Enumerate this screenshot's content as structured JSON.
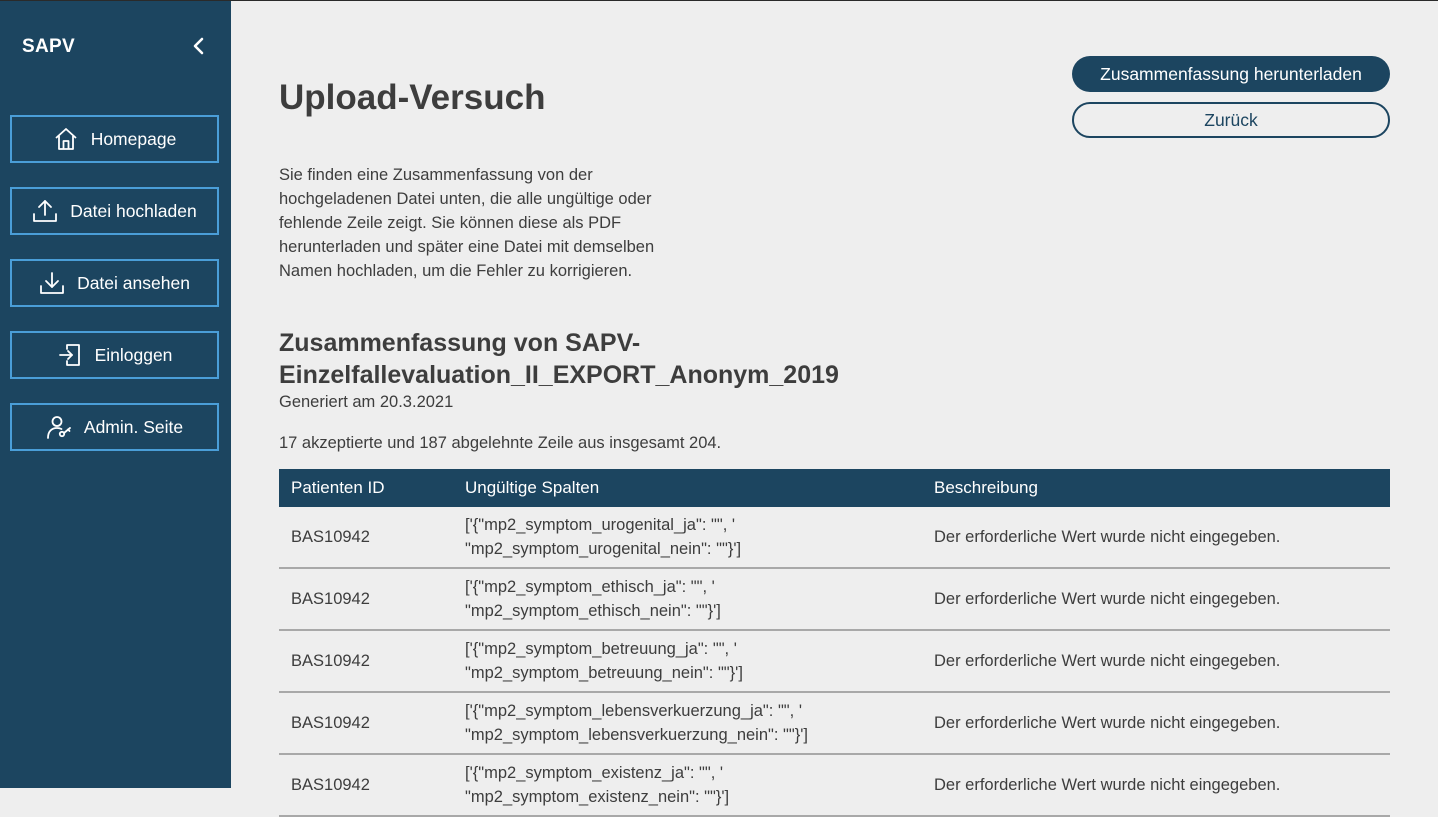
{
  "sidebar": {
    "brand": "SAPV",
    "items": [
      {
        "label": "Homepage",
        "icon": "home-icon"
      },
      {
        "label": "Datei hochladen",
        "icon": "upload-icon"
      },
      {
        "label": "Datei ansehen",
        "icon": "download-icon"
      },
      {
        "label": "Einloggen",
        "icon": "login-icon"
      },
      {
        "label": "Admin. Seite",
        "icon": "admin-user-icon"
      }
    ]
  },
  "header": {
    "title": "Upload-Versuch",
    "download_label": "Zusammenfassung herunterladen",
    "back_label": "Zurück"
  },
  "intro": "Sie finden eine Zusammenfassung von der hochgeladenen Datei unten, die alle ungültige oder fehlende Zeile zeigt. Sie können diese als PDF herunterladen und später eine Datei mit demselben Namen hochladen, um die Fehler zu korrigieren.",
  "summary": {
    "title": "Zusammenfassung von SAPV-Einzelfallevaluation_II_EXPORT_Anonym_2019",
    "generated": "Generiert am 20.3.2021",
    "counts": "17 akzeptierte und 187 abgelehnte Zeile aus insgesamt 204."
  },
  "table": {
    "headers": [
      "Patienten ID",
      "Ungültige Spalten",
      "Beschreibung"
    ],
    "rows": [
      {
        "id": "BAS10942",
        "columns": "['{\"mp2_symptom_urogenital_ja\": \"\", '\n\"mp2_symptom_urogenital_nein\": \"\"}']",
        "description": "Der erforderliche Wert wurde nicht eingegeben."
      },
      {
        "id": "BAS10942",
        "columns": "['{\"mp2_symptom_ethisch_ja\": \"\", '\n\"mp2_symptom_ethisch_nein\": \"\"}']",
        "description": "Der erforderliche Wert wurde nicht eingegeben."
      },
      {
        "id": "BAS10942",
        "columns": "['{\"mp2_symptom_betreuung_ja\": \"\", '\n\"mp2_symptom_betreuung_nein\": \"\"}']",
        "description": "Der erforderliche Wert wurde nicht eingegeben."
      },
      {
        "id": "BAS10942",
        "columns": "['{\"mp2_symptom_lebensverkuerzung_ja\": \"\", '\n\"mp2_symptom_lebensverkuerzung_nein\": \"\"}']",
        "description": "Der erforderliche Wert wurde nicht eingegeben."
      },
      {
        "id": "BAS10942",
        "columns": "['{\"mp2_symptom_existenz_ja\": \"\", '\n\"mp2_symptom_existenz_nein\": \"\"}']",
        "description": "Der erforderliche Wert wurde nicht eingegeben."
      }
    ]
  }
}
